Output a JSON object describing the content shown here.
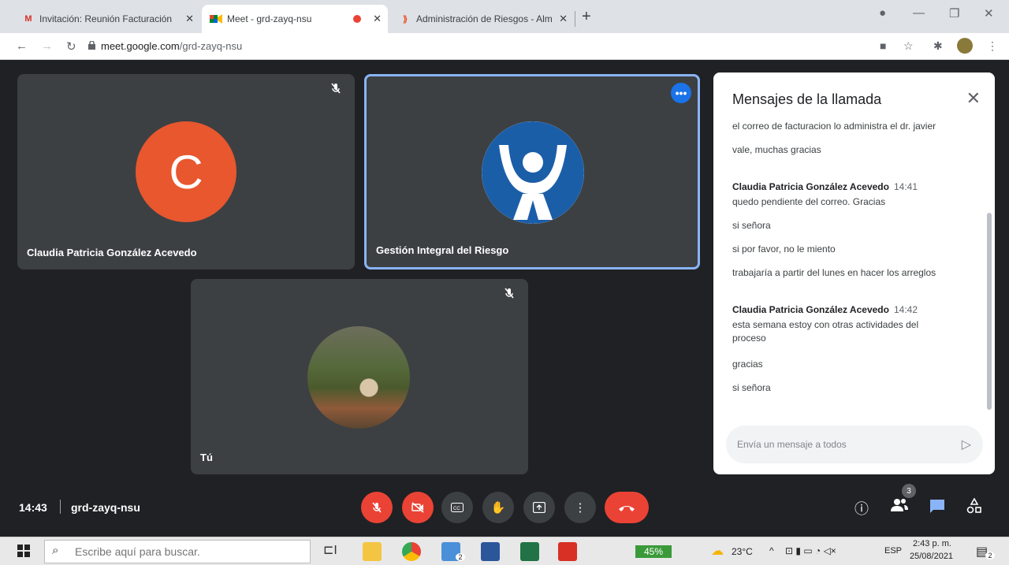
{
  "browser": {
    "tabs": [
      {
        "title": "Invitación: Reunión Facturación",
        "close": "✕"
      },
      {
        "title": "Meet - grd-zayq-nsu",
        "close": "✕"
      },
      {
        "title": "Administración de Riesgos - Alm",
        "close": "✕"
      }
    ],
    "new_tab": "+",
    "url_host": "meet.google.com",
    "url_path": "/grd-zayq-nsu"
  },
  "tiles": [
    {
      "name": "Claudia Patricia González Acevedo",
      "initial": "C"
    },
    {
      "name": "Gestión Integral del Riesgo"
    },
    {
      "name": "Tú"
    }
  ],
  "chat": {
    "title": "Mensajes de la llamada",
    "messages": [
      {
        "text": "el correo de facturacion lo administra el dr. javier"
      },
      {
        "text": "vale, muchas gracias"
      },
      {
        "sender": "Claudia Patricia González Acevedo",
        "time": "14:41",
        "text": "quedo pendiente del correo. Gracias"
      },
      {
        "text": "si señora"
      },
      {
        "text": "si por favor, no le miento"
      },
      {
        "text": "trabajaría a partir del lunes en hacer los arreglos"
      },
      {
        "sender": "Claudia Patricia González Acevedo",
        "time": "14:42",
        "text": "esta semana estoy con otras actividades del proceso"
      },
      {
        "text": "gracias"
      },
      {
        "text": "si señora"
      }
    ],
    "input_placeholder": "Envía un mensaje a todos"
  },
  "meeting": {
    "time": "14:43",
    "code": "grd-zayq-nsu",
    "participants_count": "3"
  },
  "taskbar": {
    "search_placeholder": "Escribe aquí para buscar.",
    "battery": "45%",
    "weather": "23°C",
    "lang": "ESP",
    "clock_time": "2:43 p. m.",
    "clock_date": "25/08/2021",
    "mail_badge": "2",
    "notif_badge": "2"
  },
  "colors": {
    "accent": "#1a73e8",
    "danger": "#ea4335",
    "avatar_c": "#e8572e",
    "tile_bg": "#3c4043"
  }
}
